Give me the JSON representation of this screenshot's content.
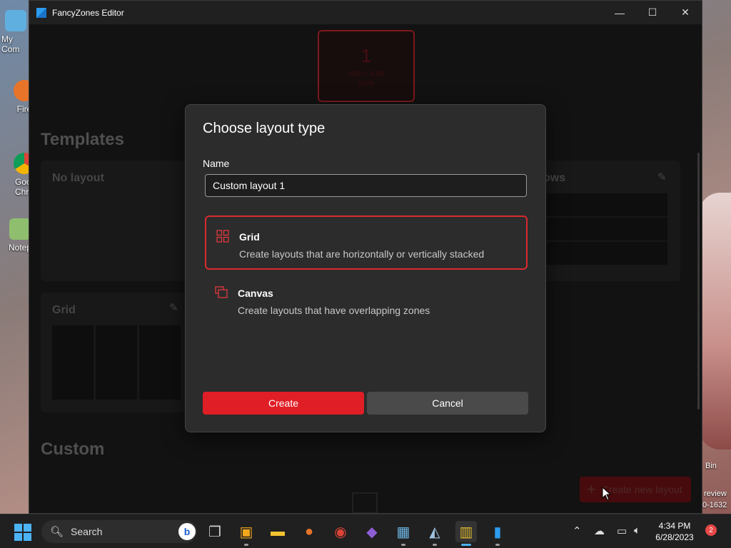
{
  "desktop": {
    "icons": [
      {
        "label": "My Com"
      },
      {
        "label": "Fire"
      },
      {
        "label": "Goo\nChro"
      },
      {
        "label": "Notep"
      }
    ],
    "right_texts": [
      "Bin",
      "review",
      "0-1632"
    ]
  },
  "window": {
    "title": "FancyZones Editor",
    "minimize": "—",
    "maximize": "☐",
    "close": "✕"
  },
  "editor": {
    "monitor_number": "1",
    "monitor_sub1": "1920 × 1080",
    "monitor_sub2": "100%",
    "templates_heading": "Templates",
    "custom_heading": "Custom",
    "cards": {
      "no_layout": "No layout",
      "rows_partial": "ows",
      "grid": "Grid"
    },
    "create_new_layout": "Create new layout"
  },
  "dialog": {
    "title": "Choose layout type",
    "name_label": "Name",
    "name_value": "Custom layout 1",
    "options": [
      {
        "name": "Grid",
        "description": "Create layouts that are horizontally or vertically stacked"
      },
      {
        "name": "Canvas",
        "description": "Create layouts that have overlapping zones"
      }
    ],
    "create_label": "Create",
    "cancel_label": "Cancel"
  },
  "taskbar": {
    "search_label": "Search",
    "time": "4:34 PM",
    "date": "6/28/2023",
    "notification_count": "2"
  }
}
